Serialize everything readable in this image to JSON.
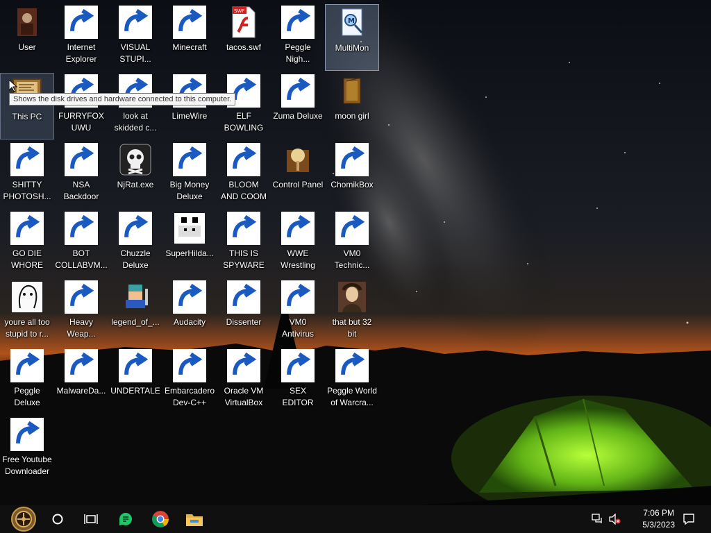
{
  "desktop": {
    "icons": [
      {
        "id": "user",
        "label": "User",
        "icon": "user-folder-icon",
        "shortcut": false
      },
      {
        "id": "internet-explorer",
        "label": "Internet\nExplorer",
        "icon": "edge-browser-icon",
        "shortcut": true
      },
      {
        "id": "visual-studio",
        "label": "VISUAL\nSTUPI...",
        "icon": "visual-studio-icon",
        "shortcut": true
      },
      {
        "id": "minecraft",
        "label": "Minecraft",
        "icon": "grass-block-icon",
        "shortcut": true
      },
      {
        "id": "tacos-swf",
        "label": "tacos.swf",
        "icon": "flash-swf-file-icon",
        "shortcut": false
      },
      {
        "id": "peggle-nights",
        "label": "Peggle\nNigh...",
        "icon": "peggle-icon",
        "shortcut": true
      },
      {
        "id": "multimon",
        "label": "MultiMon",
        "icon": "multimon-icon",
        "shortcut": false
      },
      {
        "id": "this-pc",
        "label": "This PC",
        "icon": "computer-icon",
        "shortcut": false
      },
      {
        "id": "furryfox",
        "label": "FURRYFOX\nUWU",
        "icon": "firefox-icon",
        "shortcut": true
      },
      {
        "id": "look-at-skidded",
        "label": "look at\nskidded c...",
        "icon": "stacked-windows-icon",
        "shortcut": true
      },
      {
        "id": "limewire",
        "label": "LimeWire",
        "icon": "limewire-icon",
        "shortcut": true
      },
      {
        "id": "elf-bowling",
        "label": "ELF\nBOWLING",
        "icon": "elf-bowling-icon",
        "shortcut": true
      },
      {
        "id": "zuma-deluxe",
        "label": "Zuma Deluxe",
        "icon": "zuma-icon",
        "shortcut": true
      },
      {
        "id": "moon-girl",
        "label": "moon girl",
        "icon": "folder-icon",
        "shortcut": false
      },
      {
        "id": "shitty-photoshop",
        "label": "SHITTY\nPHOTOSH...",
        "icon": "gimp-icon",
        "shortcut": true
      },
      {
        "id": "nsa-backdoor",
        "label": "NSA\nBackdoor",
        "icon": "nsa-backdoor-icon",
        "shortcut": true
      },
      {
        "id": "njrat",
        "label": "NjRat.exe",
        "icon": "skull-icon",
        "shortcut": false
      },
      {
        "id": "big-money",
        "label": "Big Money\nDeluxe",
        "icon": "money-bag-icon",
        "shortcut": true
      },
      {
        "id": "bloom-and-coom",
        "label": "BLOOM\nAND COOM",
        "icon": "flower-icon",
        "shortcut": true
      },
      {
        "id": "control-panel",
        "label": "Control Panel",
        "icon": "control-panel-icon",
        "shortcut": false
      },
      {
        "id": "chomikbox",
        "label": "ChomikBox",
        "icon": "hamster-icon",
        "shortcut": true
      },
      {
        "id": "go-die-whore",
        "label": "GO DIE\nWHORE",
        "icon": "de-letters-icon",
        "shortcut": true
      },
      {
        "id": "bot-collabvm",
        "label": "BOT\nCOLLABVM...",
        "icon": "monitor-icon",
        "shortcut": true
      },
      {
        "id": "chuzzle",
        "label": "Chuzzle\nDeluxe",
        "icon": "chuzzle-icon",
        "shortcut": true
      },
      {
        "id": "superhilda",
        "label": "SuperHilda...",
        "icon": "pixel-art-icon",
        "shortcut": false
      },
      {
        "id": "this-is-spyware",
        "label": "THIS IS\nSPYWARE",
        "icon": "chrome-icon",
        "shortcut": true
      },
      {
        "id": "wwe-wrestling",
        "label": "WWE\nWrestling",
        "icon": "wrestling-ring-icon",
        "shortcut": true
      },
      {
        "id": "vm0-technician",
        "label": "VM0\nTechnic...",
        "icon": "technician-icon",
        "shortcut": true
      },
      {
        "id": "youre-all-too-stupid",
        "label": "youre all too\nstupid to r...",
        "icon": "portrait-sketch-icon",
        "shortcut": false
      },
      {
        "id": "heavy-weapon",
        "label": "Heavy\nWeap...",
        "icon": "radiation-icon",
        "shortcut": true
      },
      {
        "id": "legend-of",
        "label": "legend_of_...",
        "icon": "pixel-hero-icon",
        "shortcut": false
      },
      {
        "id": "audacity",
        "label": "Audacity",
        "icon": "audacity-icon",
        "shortcut": true
      },
      {
        "id": "dissenter",
        "label": "Dissenter",
        "icon": "dissenter-icon",
        "shortcut": true
      },
      {
        "id": "vm0-antivirus",
        "label": "VM0\nAntivirus",
        "icon": "shield-icon",
        "shortcut": true
      },
      {
        "id": "that-but-32-bit",
        "label": "that but 32\nbit",
        "icon": "portrait-painting-icon",
        "shortcut": false
      },
      {
        "id": "peggle-deluxe",
        "label": "Peggle\nDeluxe",
        "icon": "peggle-icon",
        "shortcut": true
      },
      {
        "id": "malwareda",
        "label": "MalwareDa...",
        "icon": "folder-icon",
        "shortcut": true
      },
      {
        "id": "undertale",
        "label": "UNDERTALE",
        "icon": "unity-icon",
        "shortcut": true
      },
      {
        "id": "embarcadero",
        "label": "Embarcadero\nDev-C++",
        "icon": "devcpp-icon",
        "shortcut": true
      },
      {
        "id": "virtualbox",
        "label": "Oracle VM\nVirtualBox",
        "icon": "virtualbox-icon",
        "shortcut": true
      },
      {
        "id": "sex-editor",
        "label": "SEX\nEDITOR",
        "icon": "hxd-icon",
        "shortcut": true
      },
      {
        "id": "peggle-world",
        "label": "Peggle World\nof Warcra...",
        "icon": "peggle-icon",
        "shortcut": true
      },
      {
        "id": "free-youtube",
        "label": "Free Youtube\nDownloader",
        "icon": "youtube-downloader-icon",
        "shortcut": true
      }
    ],
    "tooltip": "Shows the disk drives and hardware connected to this computer."
  },
  "taskbar": {
    "items": [
      {
        "name": "start-button",
        "icon": "steampunk-start-icon"
      },
      {
        "name": "search-button",
        "icon": "search-circle-icon"
      },
      {
        "name": "task-view-button",
        "icon": "task-view-icon"
      },
      {
        "name": "dissenter-taskbar",
        "icon": "dissenter-icon"
      },
      {
        "name": "chrome-taskbar",
        "icon": "chrome-icon"
      },
      {
        "name": "file-explorer-taskbar",
        "icon": "folder-icon"
      }
    ],
    "tray": {
      "network_icon": "network-icon",
      "volume_icon": "volume-muted-icon",
      "notifications_icon": "notification-icon"
    },
    "time": "7:06 PM",
    "date": "5/3/2023"
  }
}
